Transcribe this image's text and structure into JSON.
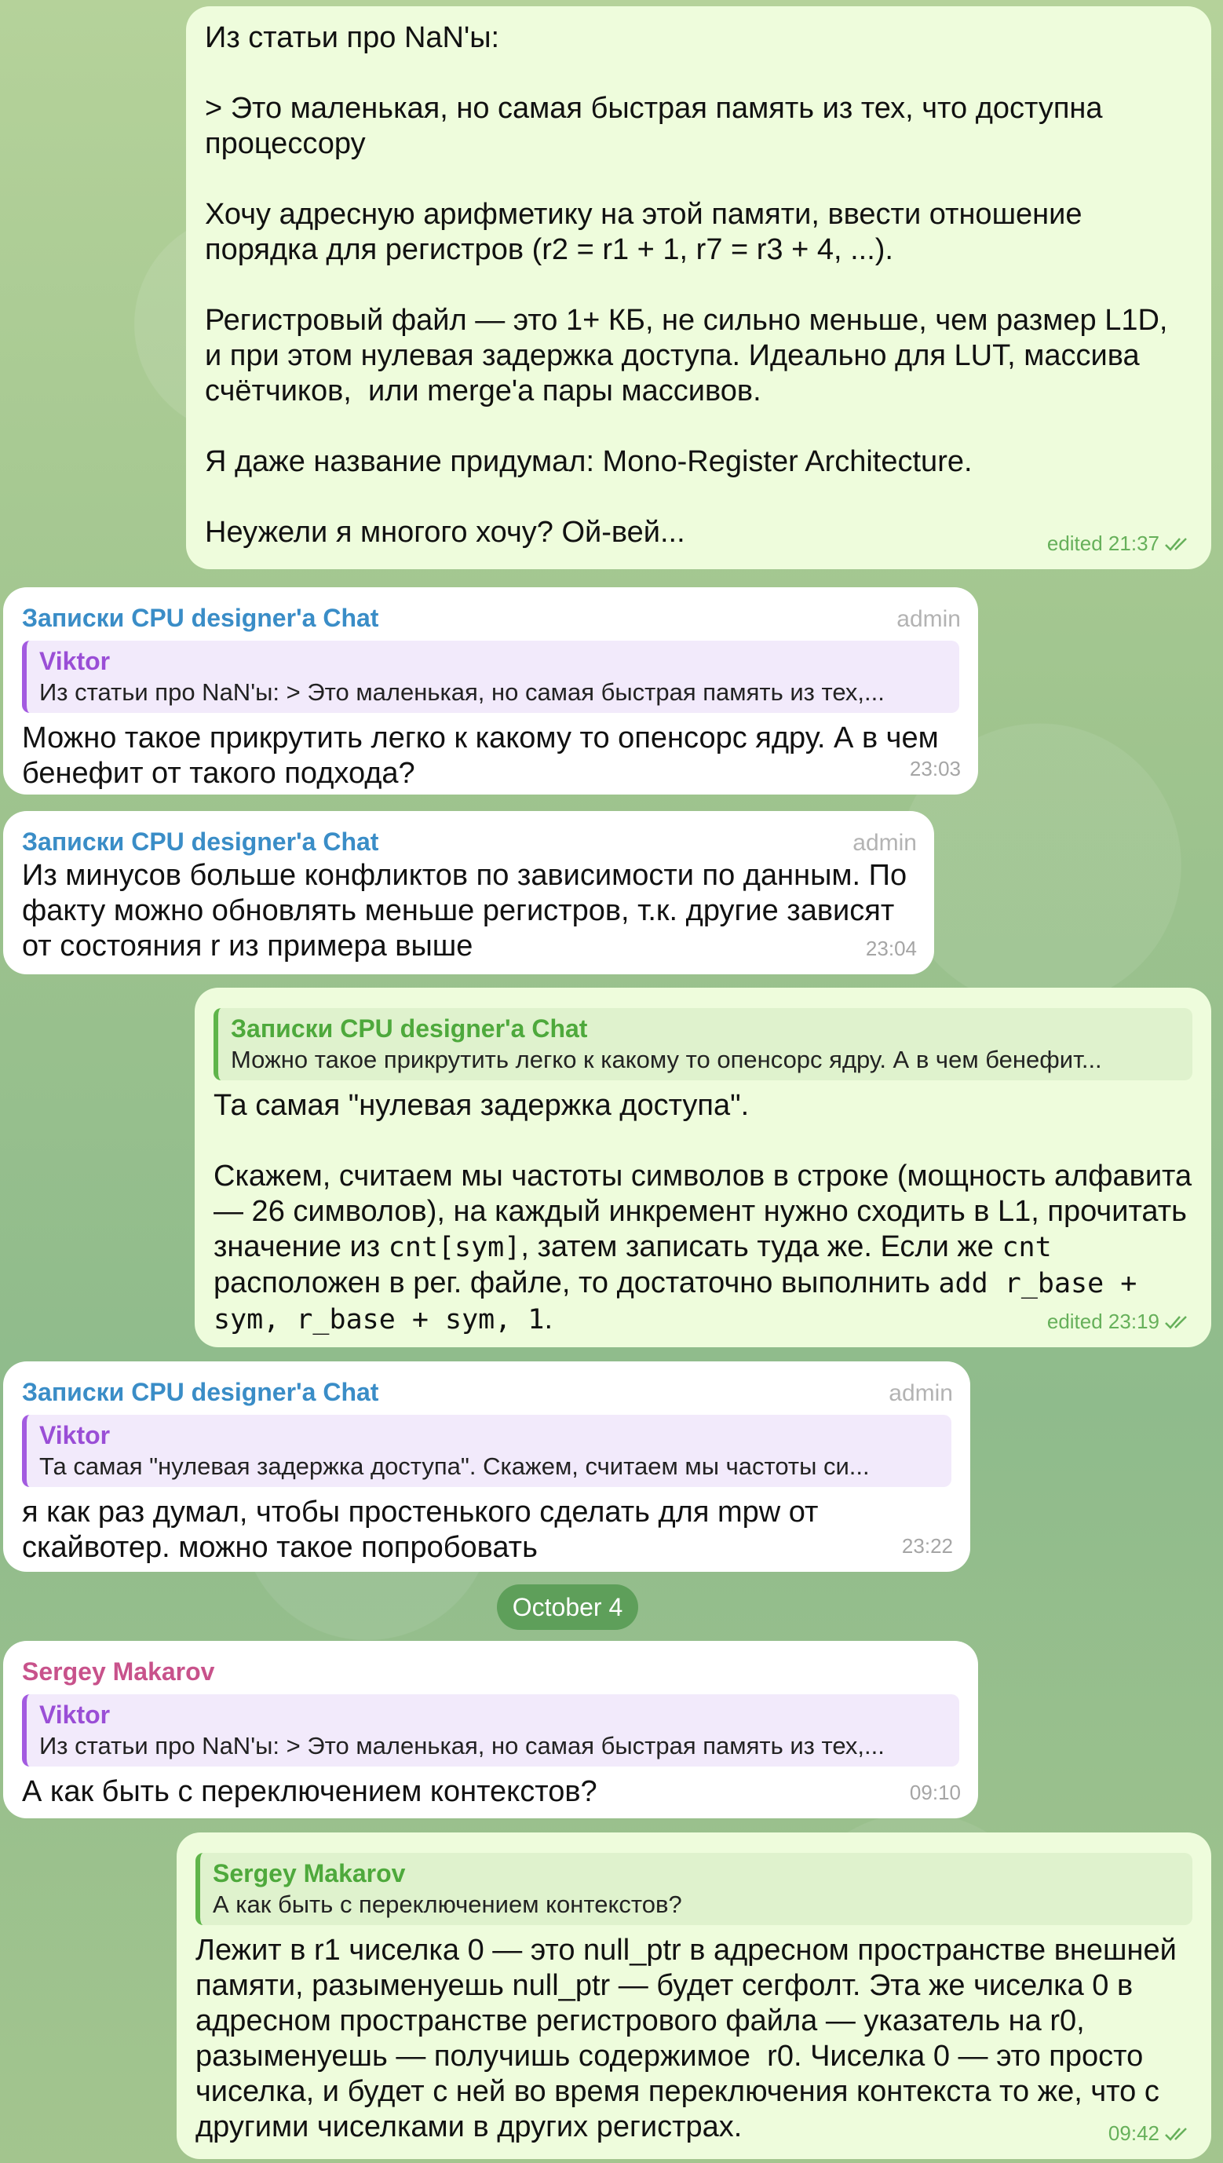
{
  "messages": {
    "m1": {
      "text": "Из статьи про NaN'ы:\n\n> Это маленькая, но самая быстрая память из тех, что доступна процессору\n\nХочу адресную арифметику на этой памяти, ввести отношение порядка для регистров (r2 = r1 + 1, r7 = r3 + 4, ...).\n\nРегистровый файл — это 1+ КБ, не сильно меньше, чем размер L1D, и при этом нулевая задержка доступа. Идеально для LUT, массива счётчиков,  или merge'а пары массивов.\n\nЯ даже название придумал: Mono-Register Architecture.\n\nНеужели я многого хочу? Ой-вей...",
      "time": "edited 21:37"
    },
    "m2": {
      "sender": "Записки CPU designer'a Chat",
      "role": "admin",
      "quote_name": "Viktor",
      "quote_text": "Из статьи про NaN'ы:  > Это маленькая, но самая быстрая память из тех,...",
      "text": "Можно такое прикрутить легко к какому то опенсорс ядру. А в чем бенефит от такого подхода?",
      "time": "23:03"
    },
    "m3": {
      "sender": "Записки CPU designer'a Chat",
      "role": "admin",
      "text": "Из минусов больше конфликтов по зависимости по данным. По факту можно обновлять меньше регистров, т.к. другие зависят от состояния r из примера выше",
      "time": "23:04"
    },
    "m4": {
      "quote_name": "Записки CPU designer'a Chat",
      "quote_text": "Можно такое прикрутить легко к какому то опенсорс ядру. А в чем бенефит...",
      "text_1": "Та самая \"нулевая задержка доступа\".\n\nСкажем, считаем мы частоты символов в строке (мощность алфавита — 26 символов), на каждый инкремент нужно сходить в L1, прочитать значение из ",
      "code_1": "cnt[sym]",
      "text_2": ", затем записать туда же. Если же ",
      "code_2": "cnt",
      "text_3": " расположен в рег. файле, то достаточно выполнить ",
      "code_3": "add r_base + sym, r_base + sym, 1",
      "text_4": ".",
      "time": "edited 23:19"
    },
    "m5": {
      "sender": "Записки CPU designer'a Chat",
      "role": "admin",
      "quote_name": "Viktor",
      "quote_text": "Та самая \"нулевая задержка доступа\".  Скажем, считаем мы частоты си...",
      "text": "я как раз думал, чтобы простенького сделать для mpw от скайвотер. можно такое попробовать",
      "time": "23:22"
    },
    "date_separator": "October 4",
    "m6": {
      "sender": "Sergey Makarov",
      "quote_name": "Viktor",
      "quote_text": "Из статьи про NaN'ы:  > Это маленькая, но самая быстрая память из тех,...",
      "text": "А как быть с переключением контекстов?",
      "time": "09:10"
    },
    "m7": {
      "quote_name": "Sergey Makarov",
      "quote_text": "А как быть с переключением контекстов?",
      "text": "Лежит в r1 чиселка 0 — это null_ptr в адресном пространстве внешней памяти, разыменуешь null_ptr — будет сегфолт. Эта же чиселка 0 в адресном пространстве регистрового файла — указатель на r0, разыменуешь — получишь содержимое  r0. Чиселка 0 — это просто чиселка, и будет с ней во время переключения контекста то же, что с другими чиселками в других регистрах.",
      "time": "09:42"
    }
  },
  "colors": {
    "outgoing_bubble": "#eefcdc",
    "incoming_bubble": "#ffffff",
    "chat_sender": "#3a8dc7",
    "sergey_sender": "#c8528b",
    "viktor_quote": "#9a4ed6",
    "green_accent": "#4ea93c"
  },
  "icons": {
    "read_receipt": "double-check-icon"
  }
}
